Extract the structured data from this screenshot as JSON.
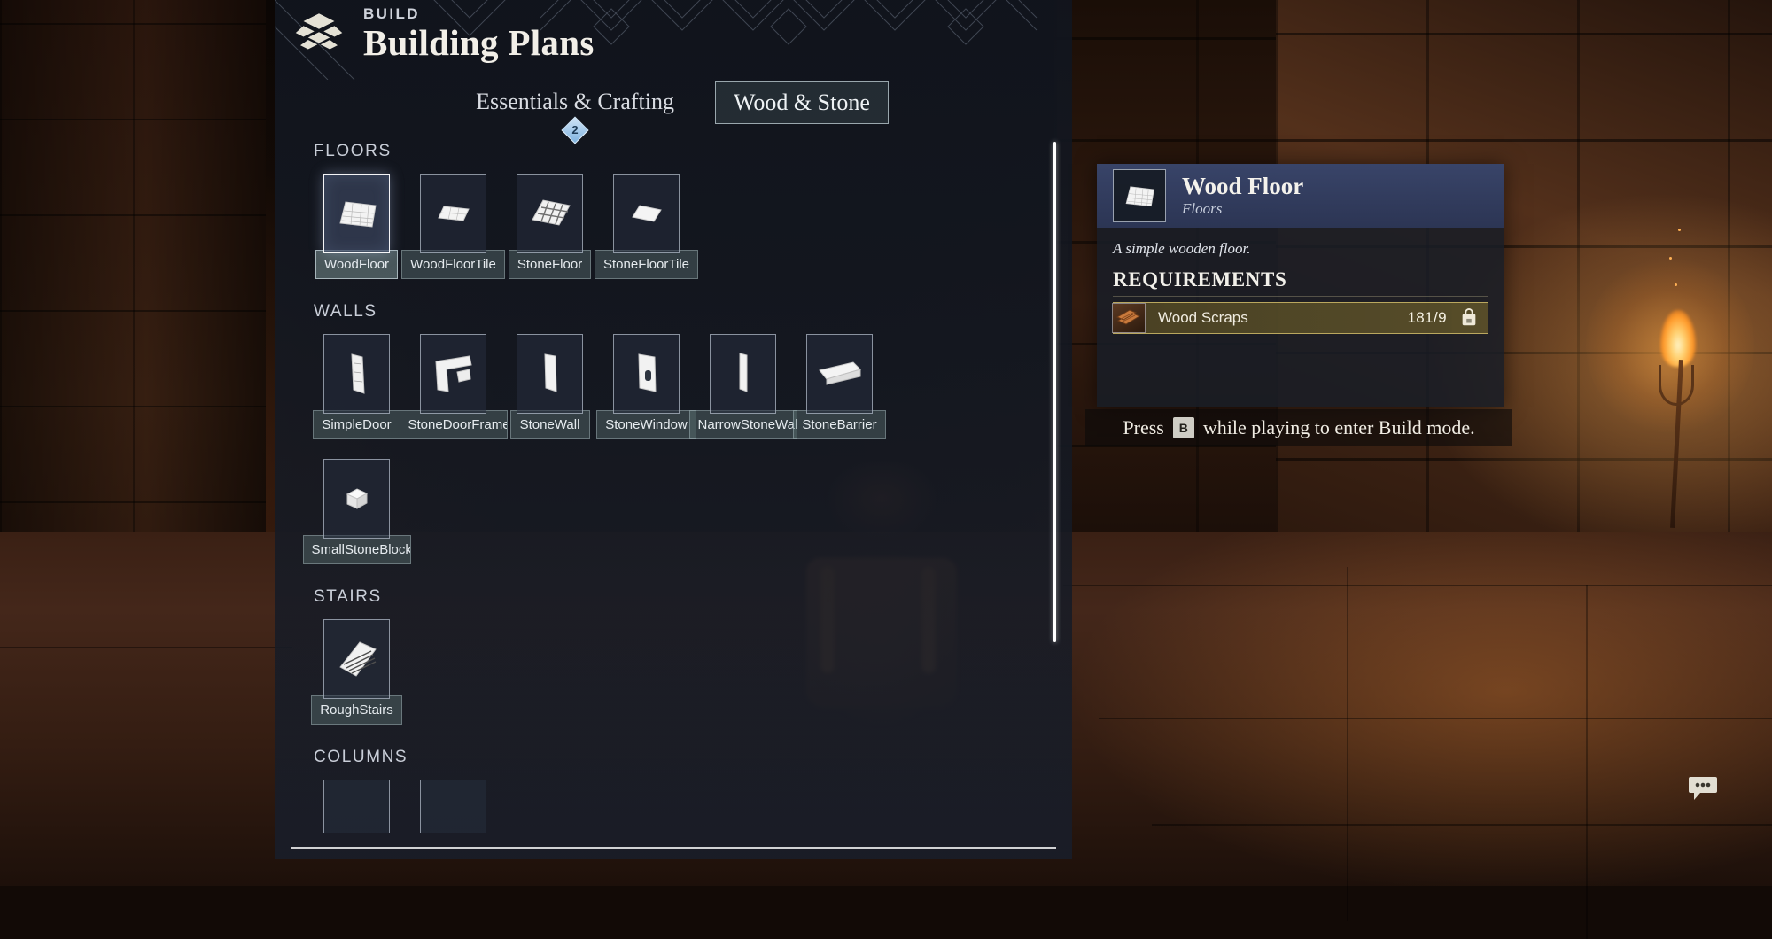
{
  "header": {
    "kicker": "BUILD",
    "title": "Building Plans",
    "icon": "stacked-blocks-icon"
  },
  "tabs": [
    {
      "label": "Essentials & Crafting",
      "active": false,
      "badge": "2"
    },
    {
      "label": "Wood & Stone",
      "active": true,
      "badge": null
    }
  ],
  "catalog": {
    "sections": [
      {
        "title": "FLOORS",
        "items": [
          {
            "name": "WoodFloor",
            "icon": "wood-floor-icon",
            "selected": true
          },
          {
            "name": "WoodFloorTile",
            "icon": "wood-floor-tile-icon",
            "selected": false
          },
          {
            "name": "StoneFloor",
            "icon": "stone-floor-icon",
            "selected": false
          },
          {
            "name": "StoneFloorTile",
            "icon": "stone-floor-tile-icon",
            "selected": false
          }
        ]
      },
      {
        "title": "WALLS",
        "items": [
          {
            "name": "SimpleDoor",
            "icon": "simple-door-icon",
            "selected": false
          },
          {
            "name": "StoneDoorFrame",
            "icon": "stone-door-frame-icon",
            "selected": false
          },
          {
            "name": "StoneWall",
            "icon": "stone-wall-icon",
            "selected": false
          },
          {
            "name": "StoneWindow",
            "icon": "stone-window-icon",
            "selected": false
          },
          {
            "name": "NarrowStoneWall",
            "icon": "narrow-stone-wall-icon",
            "selected": false
          },
          {
            "name": "StoneBarrier",
            "icon": "stone-barrier-icon",
            "selected": false
          },
          {
            "name": "SmallStoneBlock",
            "icon": "small-stone-block-icon",
            "selected": false
          }
        ]
      },
      {
        "title": "STAIRS",
        "items": [
          {
            "name": "RoughStairs",
            "icon": "rough-stairs-icon",
            "selected": false
          }
        ]
      },
      {
        "title": "COLUMNS",
        "items": [
          {
            "name": "",
            "icon": "column-icon",
            "selected": false
          },
          {
            "name": "",
            "icon": "column-icon",
            "selected": false
          }
        ]
      }
    ]
  },
  "info": {
    "title": "Wood Floor",
    "subtitle": "Floors",
    "description": "A simple wooden floor.",
    "requirements_title": "REQUIREMENTS",
    "requirements": [
      {
        "name": "Wood Scraps",
        "count": "181/9",
        "icon": "wood-scraps-icon",
        "storage_icon": "backpack-icon"
      }
    ]
  },
  "hint": {
    "prefix": "Press",
    "key": "B",
    "suffix": "while playing to enter Build mode."
  },
  "overlay": {
    "chat_icon": "chat-bubble-icon"
  },
  "colors": {
    "accent_badge": "#7fb3e0",
    "requirement_gold": "#cdb868",
    "panel_bg": "#141925",
    "info_head": "#3a466c"
  }
}
